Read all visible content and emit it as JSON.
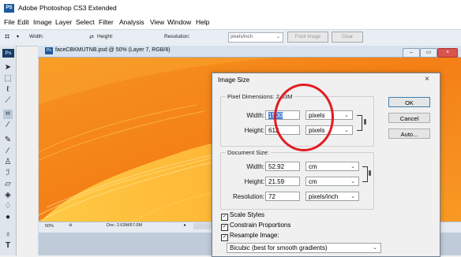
{
  "app": {
    "title": "Adobe Photoshop CS3 Extended",
    "icon_label": "PS"
  },
  "menu": [
    "File",
    "Edit",
    "Image",
    "Layer",
    "Select",
    "Filter",
    "Analysis",
    "View",
    "Window",
    "Help"
  ],
  "options_bar": {
    "width_label": "Width:",
    "height_label": "Height:",
    "resolution_label": "Resolution:",
    "resolution_unit": "pixels/inch",
    "front_image_button": "Front Image",
    "clear_button": "Clear"
  },
  "toolbox": {
    "logo": "Ps",
    "tools": [
      "move-tool-icon",
      "marquee-tool-icon",
      "lasso-tool-icon",
      "quick-select-tool-icon",
      "crop-tool-icon",
      "eyedropper-tool-icon",
      "healing-brush-icon",
      "brush-tool-icon",
      "clone-stamp-icon",
      "history-brush-icon",
      "eraser-icon",
      "paint-bucket-icon",
      "blur-tool-icon",
      "dodge-tool-icon",
      "pen-tool-icon",
      "type-tool-icon"
    ]
  },
  "document": {
    "title": "faceCBKMUTNB.psd @ 50% (Layer 7, RGB/8)",
    "zoom": "50%",
    "doc_size": "Doc: 2.63M/67.0M"
  },
  "dialog": {
    "title": "Image Size",
    "pixel_dimensions_legend": "Pixel Dimensions: 2.63M",
    "pd_width_label": "Width:",
    "pd_width_value": "1500",
    "pd_width_unit": "pixels",
    "pd_height_label": "Height:",
    "pd_height_value": "612",
    "pd_height_unit": "pixels",
    "document_size_legend": "Document Size:",
    "ds_width_label": "Width:",
    "ds_width_value": "52.92",
    "ds_width_unit": "cm",
    "ds_height_label": "Height:",
    "ds_height_value": "21.59",
    "ds_height_unit": "cm",
    "resolution_label": "Resolution:",
    "resolution_value": "72",
    "resolution_unit": "pixels/inch",
    "scale_styles": "Scale Styles",
    "constrain_proportions": "Constrain Proportions",
    "resample_image": "Resample Image:",
    "resample_method": "Bicubic (best for smooth gradients)",
    "ok_button": "OK",
    "cancel_button": "Cancel",
    "auto_button": "Auto...",
    "close_glyph": "×"
  },
  "colors": {
    "canvas_orange": "#f28a1c",
    "canvas_light": "#ffc33a",
    "highlight_circle": "#e31b23",
    "selected_field": "#3b7fe0"
  }
}
